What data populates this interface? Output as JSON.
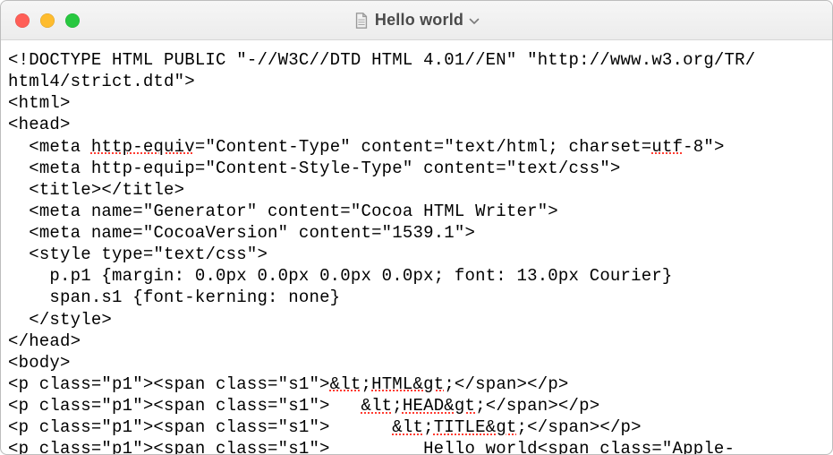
{
  "titlebar": {
    "doc_title": "Hello world"
  },
  "code": {
    "l01a": "<!DOCTYPE HTML PUBLIC \"-//W3C//DTD HTML 4.01//EN\" \"http://www.w3.org/TR/",
    "l01b": "html4/strict.dtd\">",
    "l02": "<html>",
    "l03": "<head>",
    "l04a": "  <meta ",
    "l04b": "http-equiv",
    "l04c": "=\"Content-Type\" content=\"text/html; charset=",
    "l04d": "utf",
    "l04e": "-8\">",
    "l05": "  <meta http-equip=\"Content-Style-Type\" content=\"text/css\">",
    "l06": "  <title></title>",
    "l07": "  <meta name=\"Generator\" content=\"Cocoa HTML Writer\">",
    "l08": "  <meta name=\"CocoaVersion\" content=\"1539.1\">",
    "l09": "  <style type=\"text/css\">",
    "l10": "    p.p1 {margin: 0.0px 0.0px 0.0px 0.0px; font: 13.0px Courier}",
    "l11": "    span.s1 {font-kerning: none}",
    "l12": "  </style>",
    "l13": "</head>",
    "l14": "<body>",
    "l15a": "<p class=\"p1\"><span class=\"s1\">",
    "l15b": "&lt",
    "l15c": ";",
    "l15d": "HTML&gt",
    "l15e": ";</span></p>",
    "l16a": "<p class=\"p1\"><span class=\"s1\">   ",
    "l16b": "&lt",
    "l16c": ";",
    "l16d": "HEAD&gt",
    "l16e": ";</span></p>",
    "l17a": "<p class=\"p1\"><span class=\"s1\">      ",
    "l17b": "&lt",
    "l17c": ";",
    "l17d": "TITLE&gt",
    "l17e": ";</span></p>",
    "l18": "<p class=\"p1\"><span class=\"s1\">         Hello world<span class=\"Apple-"
  }
}
